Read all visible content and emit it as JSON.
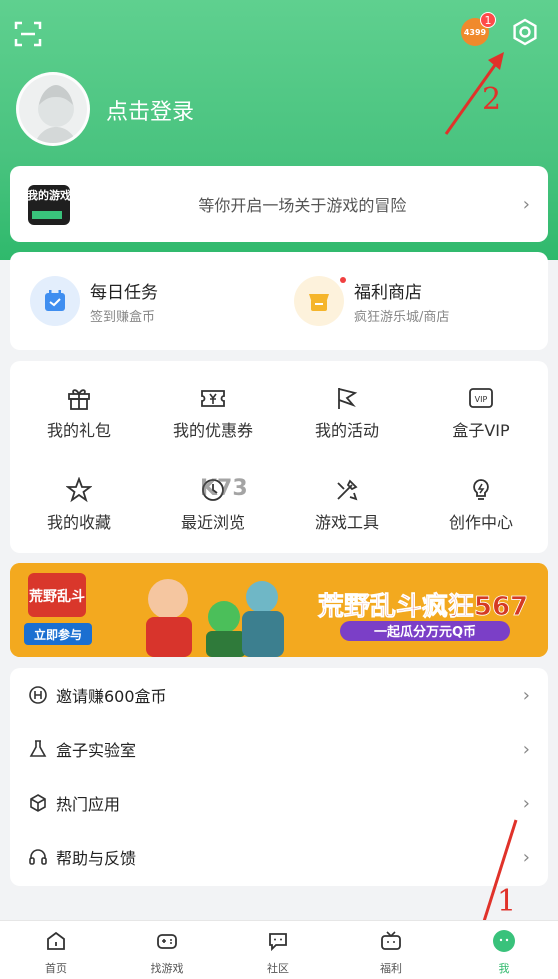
{
  "header": {
    "coin_logo": "4399",
    "badge_count": "1",
    "login_text": "点击登录"
  },
  "annotations": {
    "arrow_1_label": "1",
    "arrow_2_label": "2"
  },
  "banner": {
    "logo_text": "我的游戏",
    "text": "等你开启一场关于游戏的冒险"
  },
  "tasks": [
    {
      "title": "每日任务",
      "subtitle": "签到赚盒币"
    },
    {
      "title": "福利商店",
      "subtitle": "疯狂游乐城/商店"
    }
  ],
  "grid": [
    {
      "label": "我的礼包",
      "icon": "gift-icon"
    },
    {
      "label": "我的优惠券",
      "icon": "coupon-icon"
    },
    {
      "label": "我的活动",
      "icon": "flag-icon"
    },
    {
      "label": "盒子VIP",
      "icon": "vip-icon"
    },
    {
      "label": "我的收藏",
      "icon": "star-icon"
    },
    {
      "label": "最近浏览",
      "icon": "history-icon"
    },
    {
      "label": "游戏工具",
      "icon": "tool-icon"
    },
    {
      "label": "创作中心",
      "icon": "bulb-icon"
    }
  ],
  "watermark": "K73",
  "promo": {
    "game_logo": "荒野乱斗",
    "join_label": "立即参与",
    "title": "荒野乱斗疯狂567",
    "subtitle": "一起瓜分万元Q币"
  },
  "menu": [
    {
      "label": "邀请赚600盒币",
      "icon": "h-coin-icon"
    },
    {
      "label": "盒子实验室",
      "icon": "flask-icon"
    },
    {
      "label": "热门应用",
      "icon": "cube-icon"
    },
    {
      "label": "帮助与反馈",
      "icon": "headset-icon"
    }
  ],
  "tabs": [
    {
      "label": "首页",
      "icon": "home-icon"
    },
    {
      "label": "找游戏",
      "icon": "gamepad-icon"
    },
    {
      "label": "社区",
      "icon": "chat-icon"
    },
    {
      "label": "福利",
      "icon": "tv-icon"
    },
    {
      "label": "我",
      "icon": "me-icon"
    }
  ],
  "colors": {
    "brand_green": "#2fb96c",
    "annotation_red": "#e0322a"
  }
}
